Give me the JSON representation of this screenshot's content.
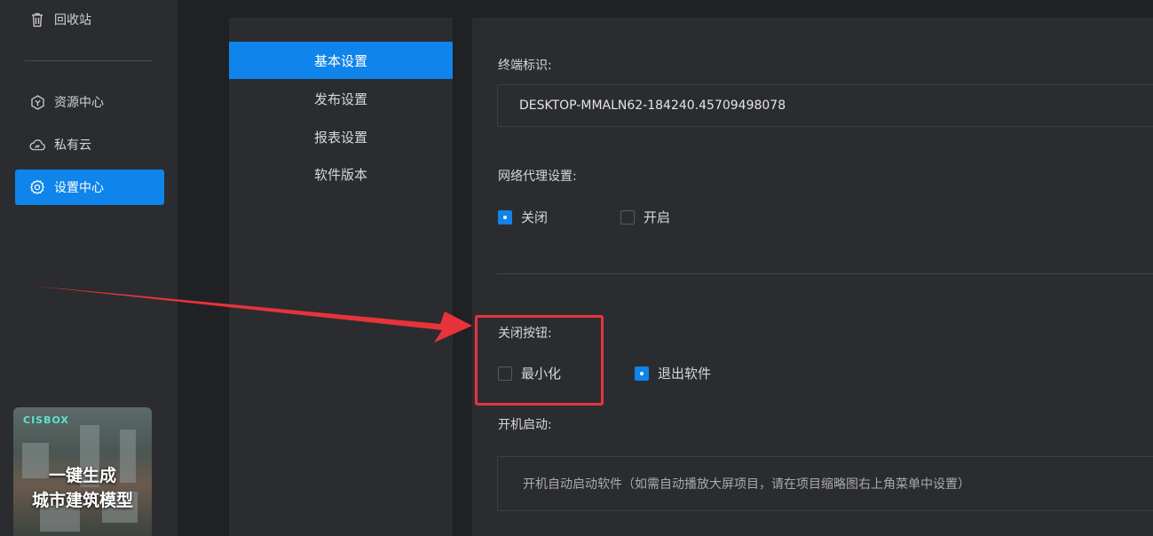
{
  "sidebar": {
    "items": [
      {
        "label": "回收站",
        "icon": "trash-icon"
      },
      {
        "label": "资源中心",
        "icon": "cube-icon"
      },
      {
        "label": "私有云",
        "icon": "cloud-icon"
      },
      {
        "label": "设置中心",
        "icon": "gear-icon",
        "active": true
      }
    ],
    "promo": {
      "logo": "CISBOX",
      "line1": "一键生成",
      "line2": "城市建筑模型"
    }
  },
  "submenu": {
    "items": [
      {
        "label": "基本设置",
        "active": true
      },
      {
        "label": "发布设置"
      },
      {
        "label": "报表设置"
      },
      {
        "label": "软件版本"
      }
    ]
  },
  "main": {
    "terminal_id": {
      "label": "终端标识:",
      "value": "DESKTOP-MMALN62-184240.45709498078"
    },
    "proxy": {
      "label": "网络代理设置:",
      "options": [
        {
          "label": "关闭",
          "checked": true
        },
        {
          "label": "开启",
          "checked": false
        }
      ]
    },
    "close_button": {
      "label": "关闭按钮:",
      "options": [
        {
          "label": "最小化",
          "checked": false
        },
        {
          "label": "退出软件",
          "checked": true
        }
      ]
    },
    "startup": {
      "label": "开机启动:",
      "text": "开机自动启动软件（如需自动播放大屏项目，请在项目缩略图右上角菜单中设置）"
    }
  },
  "colors": {
    "accent": "#0f84ea",
    "annotation": "#e6343a",
    "background": "#2b2c30"
  }
}
